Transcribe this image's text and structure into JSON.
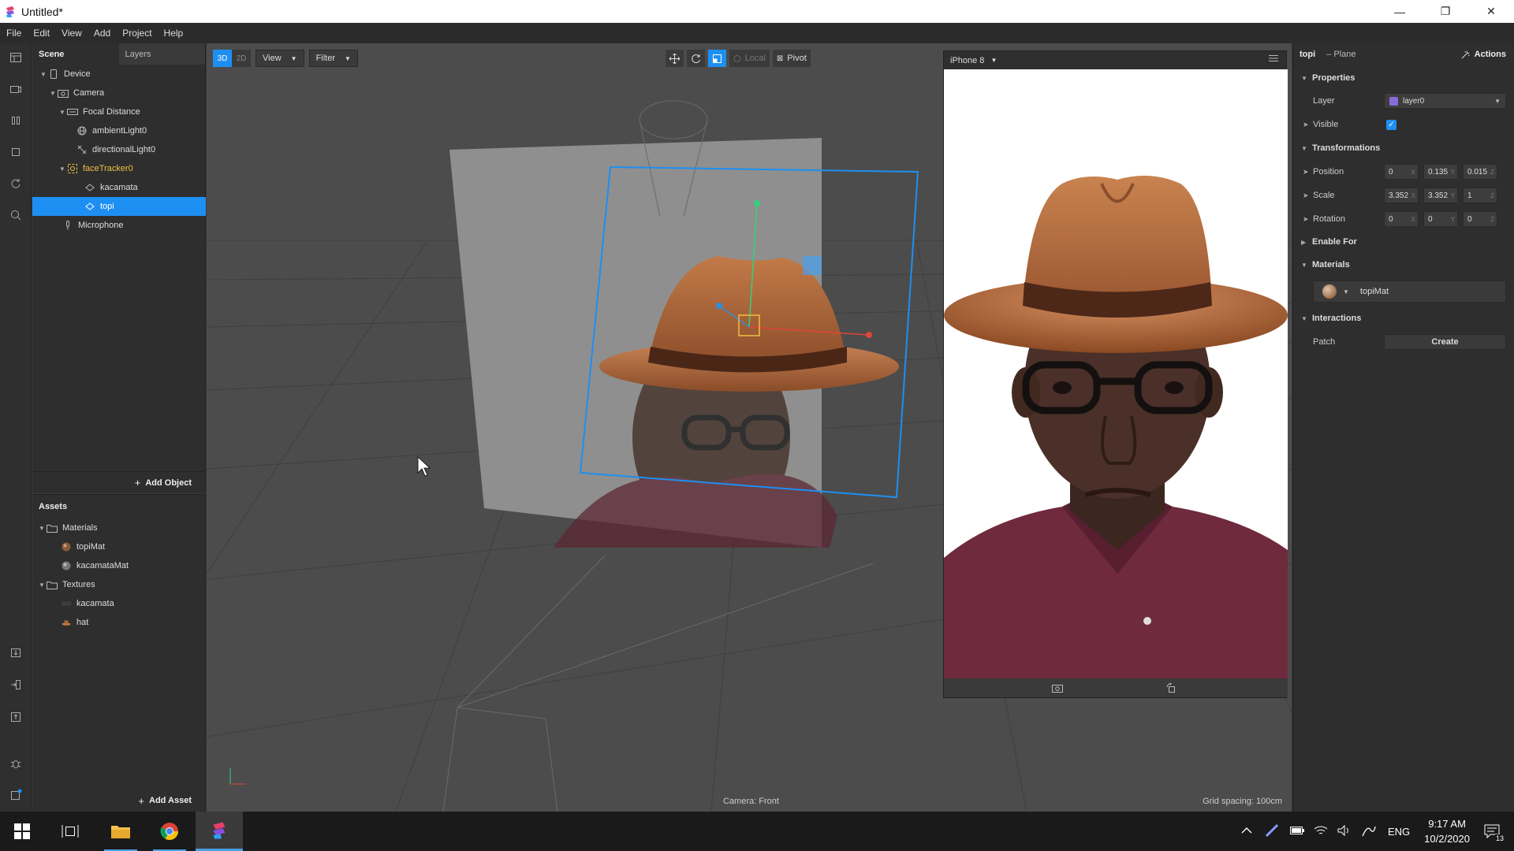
{
  "window": {
    "title": "Untitled*",
    "controls": [
      "minimize",
      "restore",
      "close"
    ]
  },
  "menu": [
    "File",
    "Edit",
    "View",
    "Add",
    "Project",
    "Help"
  ],
  "scene_panel": {
    "tabs": [
      "Scene",
      "Layers"
    ],
    "tree": [
      {
        "label": "Device",
        "icon": "device-icon"
      },
      {
        "label": "Camera",
        "icon": "camera-icon"
      },
      {
        "label": "Focal Distance",
        "icon": "focal-distance-icon"
      },
      {
        "label": "ambientLight0",
        "icon": "ambient-light-icon"
      },
      {
        "label": "directionalLight0",
        "icon": "directional-light-icon"
      },
      {
        "label": "faceTracker0",
        "icon": "face-tracker-icon"
      },
      {
        "label": "kacamata",
        "icon": "plane-icon"
      },
      {
        "label": "topi",
        "icon": "plane-icon",
        "selected": true
      },
      {
        "label": "Microphone",
        "icon": "microphone-icon"
      }
    ],
    "add_object": "Add Object"
  },
  "assets_panel": {
    "title": "Assets",
    "tree": [
      {
        "label": "Materials",
        "icon": "folder-icon"
      },
      {
        "label": "topiMat",
        "icon": "material-icon"
      },
      {
        "label": "kacamataMat",
        "icon": "material-icon"
      },
      {
        "label": "Textures",
        "icon": "folder-icon"
      },
      {
        "label": "kacamata",
        "icon": "texture-icon"
      },
      {
        "label": "hat",
        "icon": "texture-icon"
      }
    ],
    "add_asset": "Add Asset"
  },
  "viewport": {
    "mode_3d": "3D",
    "mode_2d": "2D",
    "view_btn": "View",
    "filter_btn": "Filter",
    "local_btn": "Local",
    "pivot_btn": "Pivot",
    "camera_label": "Camera: Front",
    "grid_label": "Grid spacing: 100cm"
  },
  "simulator": {
    "device": "iPhone 8"
  },
  "inspector": {
    "object": "topi",
    "type": "– Plane",
    "actions": "Actions",
    "sections": {
      "properties": "Properties",
      "transformations": "Transformations",
      "enable_for": "Enable For",
      "materials": "Materials",
      "interactions": "Interactions"
    },
    "layer_label": "Layer",
    "layer_value": "layer0",
    "layer_color": "#8a6ad9",
    "visible_label": "Visible",
    "position_label": "Position",
    "position": [
      "0",
      "0.135",
      "0.015"
    ],
    "scale_label": "Scale",
    "scale": [
      "3.352",
      "3.352",
      "1"
    ],
    "rotation_label": "Rotation",
    "rotation": [
      "0",
      "0",
      "0"
    ],
    "axes": [
      "X",
      "Y",
      "Z"
    ],
    "material_value": "topiMat",
    "patch_label": "Patch",
    "create_btn": "Create"
  },
  "taskbar": {
    "tray_lang": "ENG",
    "time": "9:17 AM",
    "date": "10/2/2020",
    "notifications": "13"
  },
  "colors": {
    "accent": "#1e8ff2",
    "hat": "#a9653a",
    "shirt": "#6f2a3e"
  }
}
